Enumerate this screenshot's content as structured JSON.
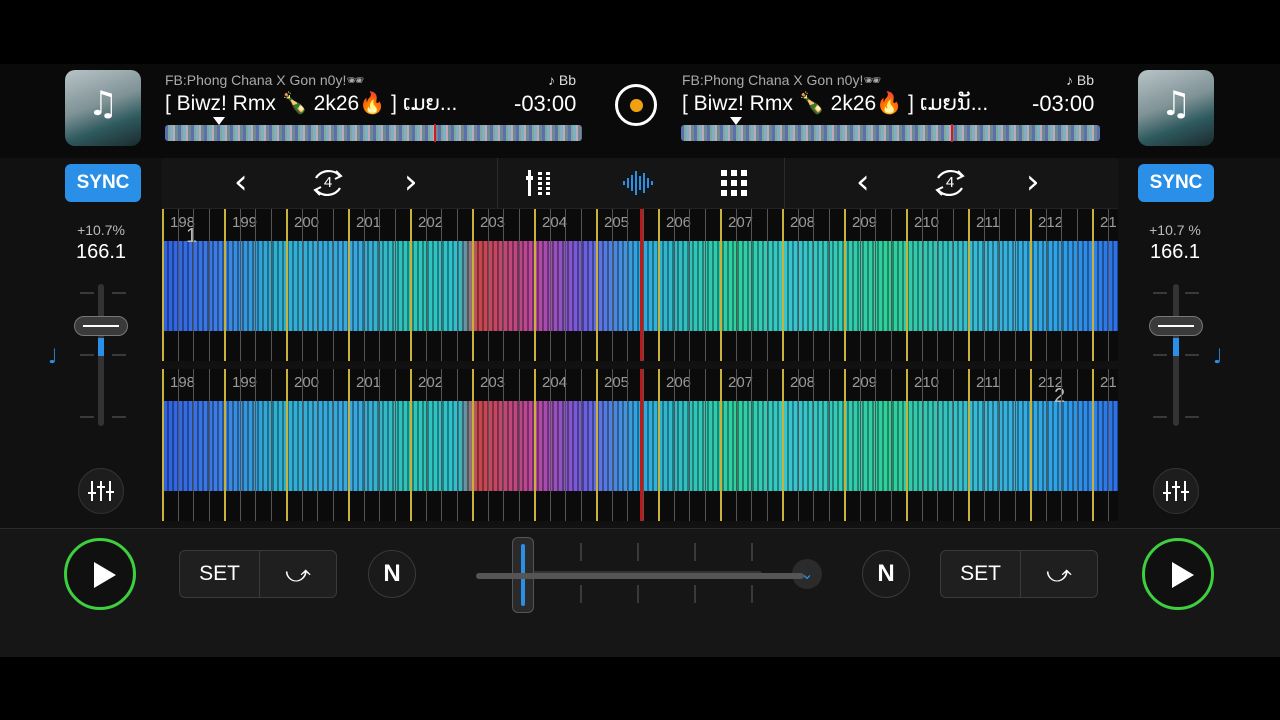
{
  "deck_left": {
    "artist": "FB:Phong Chana X Gon n0y!🕶",
    "title": "[ Biwz! Rmx  🍾 2k26🔥 ] ເມຍ...",
    "time": "-03:00",
    "key": "♪ Bb",
    "art_icon": "♫",
    "sync_label": "SYNC",
    "pitch_percent": "+10.7%",
    "bpm": "166.1",
    "deck_number": "1",
    "loop_size": "4"
  },
  "deck_right": {
    "artist": "FB:Phong Chana X Gon n0y!🕶",
    "title": "[ Biwz! Rmx  🍾 2k26🔥 ] ເມຍນັ...",
    "time": "-03:00",
    "key": "♪ Bb",
    "art_icon": "♫",
    "sync_label": "SYNC",
    "pitch_percent": "+10.7 %",
    "bpm": "166.1",
    "deck_number": "2",
    "loop_size": "4"
  },
  "bar_numbers": [
    "198",
    "199",
    "200",
    "201",
    "202",
    "203",
    "204",
    "205",
    "206",
    "207",
    "208",
    "209",
    "210",
    "211",
    "212",
    "21"
  ],
  "bottom": {
    "set_label": "SET",
    "n_label": "N",
    "cue_icon": "⤻"
  },
  "icons": {
    "prev": "‹",
    "next": "›",
    "mixer": "mixer-icon",
    "waveform": "waveform-icon",
    "grid": "pads-grid-icon",
    "eq": "eq-sliders-icon",
    "chevron_down": "⌄"
  },
  "colors": {
    "accent": "#2a8fe6",
    "play_ring": "#3ecf3e",
    "playhead": "#c01818",
    "record_dot": "#f0a010"
  }
}
